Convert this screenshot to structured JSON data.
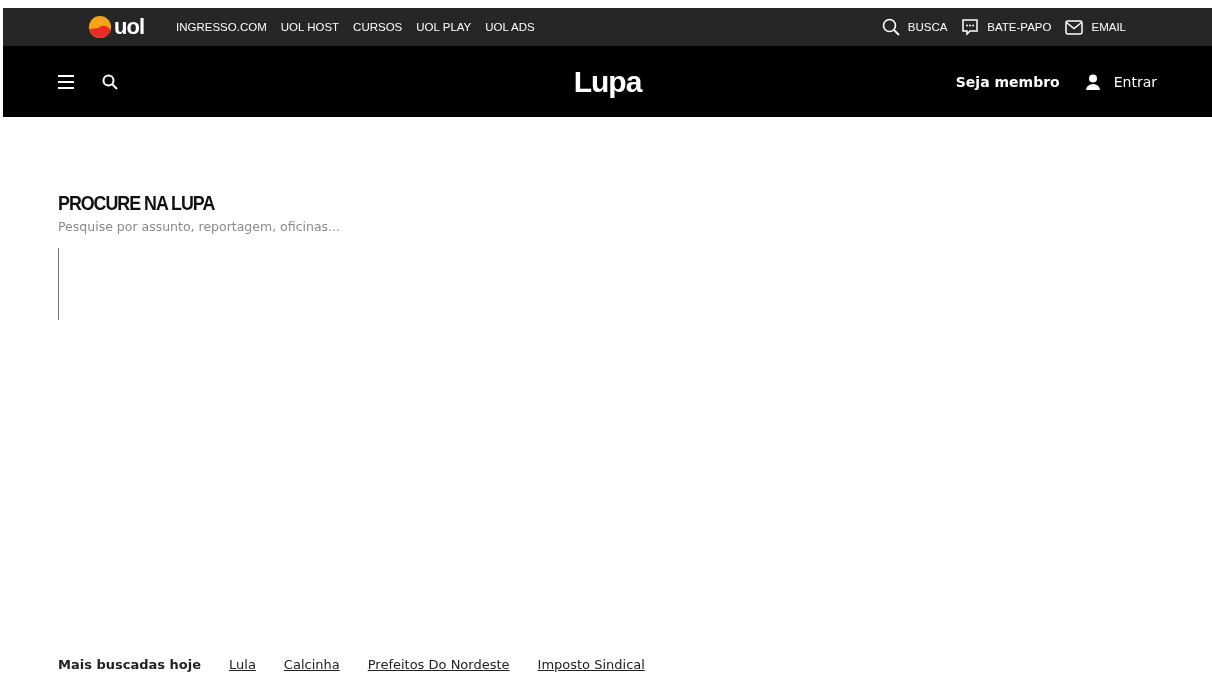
{
  "top_bar": {
    "logo": "uol",
    "links": [
      "INGRESSO.COM",
      "UOL HOST",
      "CURSOS",
      "UOL PLAY",
      "UOL ADS"
    ],
    "actions": [
      {
        "kind": "search",
        "label": "BUSCA"
      },
      {
        "kind": "chat",
        "label": "BATE-PAPO"
      },
      {
        "kind": "mail",
        "label": "EMAIL"
      }
    ]
  },
  "header": {
    "title": "Lupa",
    "member": "Seja membro",
    "login": "Entrar"
  },
  "search": {
    "heading": "PROCURE NA LUPA",
    "hint": "Pesquise por assunto, reportagem, oficinas..."
  },
  "trending": {
    "label": "Mais buscadas hoje",
    "links": [
      "Lula",
      "Calcinha",
      "Prefeitos Do Nordeste",
      "Imposto Sindical"
    ]
  }
}
